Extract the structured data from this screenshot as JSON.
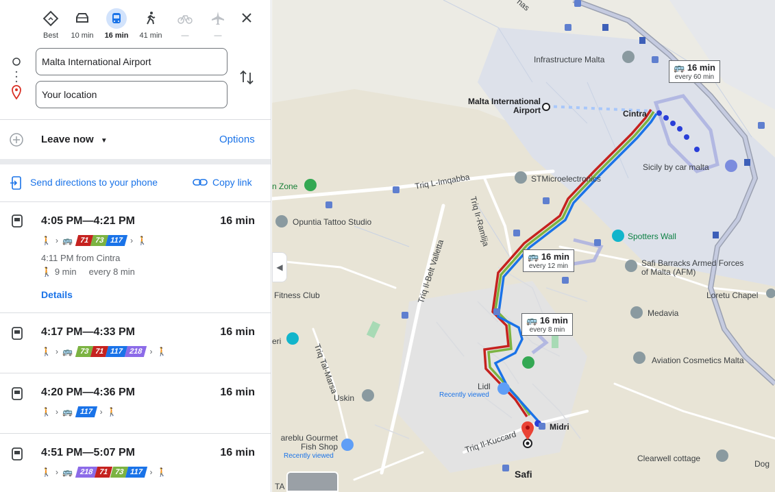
{
  "modes": [
    {
      "id": "best",
      "label": "Best"
    },
    {
      "id": "drive",
      "label": "10 min"
    },
    {
      "id": "transit",
      "label": "16 min"
    },
    {
      "id": "walk",
      "label": "41 min"
    },
    {
      "id": "bike",
      "label": "—"
    },
    {
      "id": "flight",
      "label": "—"
    }
  ],
  "origin": "Malta International Airport",
  "destination": "Your location",
  "leave": "Leave now",
  "options": "Options",
  "send": "Send directions to your phone",
  "copy": "Copy link",
  "colors": {
    "accent": "#1a73e8",
    "r71": "#c5221f",
    "r73": "#7cb342",
    "r117": "#1a73e8",
    "r218": "#8c6be8"
  },
  "routes": [
    {
      "time": "4:05 PM—4:21 PM",
      "dur": "16 min",
      "lines": [
        "71",
        "73",
        "117"
      ],
      "from": "4:11 PM from Cintra",
      "walk": "9 min",
      "freq": "every 8 min",
      "details": "Details"
    },
    {
      "time": "4:17 PM—4:33 PM",
      "dur": "16 min",
      "lines": [
        "73",
        "71",
        "117",
        "218"
      ]
    },
    {
      "time": "4:20 PM—4:36 PM",
      "dur": "16 min",
      "lines": [
        "117"
      ]
    },
    {
      "time": "4:51 PM—5:07 PM",
      "dur": "16 min",
      "lines": [
        "218",
        "71",
        "73",
        "117"
      ]
    }
  ],
  "map": {
    "labels": {
      "infra": "Infrastructure Malta",
      "airport": "Malta International Airport",
      "cintra": "Cintra",
      "sicily": "Sicily by car malta",
      "stmicro": "STMicroelectronics",
      "zone": "n Zone",
      "imqabba": "Triq L-Imqabba",
      "ramlija": "Triq Ir-Ramlija",
      "opuntia": "Opuntia Tattoo Studio",
      "spotters": "Spotters Wall",
      "safi_barracks": "Safi Barracks Armed Forces of Malta (AFM)",
      "loretu": "Loretu Chapel",
      "medavia": "Medavia",
      "belt": "Triq Il-Belt Valletta",
      "fitness": "Fitness Club",
      "aviation": "Aviation Cosmetics Malta",
      "eri": "eri",
      "marsa": "Triq Tal-Marsa",
      "lidl": "Lidl",
      "recent": "Recently viewed",
      "uskin": "Uskin",
      "midri": "Midri",
      "kuccard": "Triq Il-Kuccard",
      "gourmet": "areblu Gourmet Fish Shop",
      "clearwell": "Clearwell cottage",
      "dog": "Dog",
      "safi": "Safi",
      "ta": "TA",
      "nas": "nas"
    },
    "bubbles": [
      {
        "time": "16 min",
        "freq": "every 60 min"
      },
      {
        "time": "16 min",
        "freq": "every 12 min"
      },
      {
        "time": "16 min",
        "freq": "every 8 min"
      }
    ]
  }
}
